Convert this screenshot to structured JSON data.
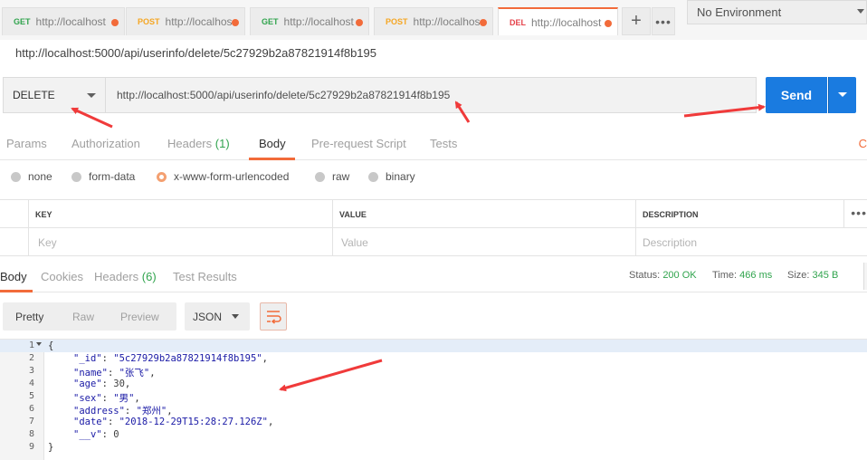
{
  "tabs": [
    {
      "method": "GET",
      "url": "http://localhost"
    },
    {
      "method": "POST",
      "url": "http://localhos"
    },
    {
      "method": "GET",
      "url": "http://localhost"
    },
    {
      "method": "POST",
      "url": "http://localhos"
    },
    {
      "method": "DEL",
      "url": "http://localhost"
    }
  ],
  "tab_controls": {
    "add": "+",
    "more": "•••"
  },
  "environment": {
    "selected": "No Environment"
  },
  "request": {
    "title": "http://localhost:5000/api/userinfo/delete/5c27929b2a87821914f8b195",
    "method": "DELETE",
    "url": "http://localhost:5000/api/userinfo/delete/5c27929b2a87821914f8b195",
    "send_label": "Send"
  },
  "request_tabs": {
    "params": "Params",
    "authorization": "Authorization",
    "headers": "Headers",
    "headers_count": "(1)",
    "body": "Body",
    "prerequest": "Pre-request Script",
    "tests": "Tests",
    "cookies_edge": "C"
  },
  "body_modes": {
    "none": "none",
    "form_data": "form-data",
    "urlencoded": "x-www-form-urlencoded",
    "raw": "raw",
    "binary": "binary"
  },
  "kv_table": {
    "headers": {
      "key": "KEY",
      "value": "VALUE",
      "description": "DESCRIPTION"
    },
    "placeholders": {
      "key": "Key",
      "value": "Value",
      "description": "Description"
    },
    "more": "•••"
  },
  "response_tabs": {
    "body": "Body",
    "cookies": "Cookies",
    "headers": "Headers",
    "headers_count": "(6)",
    "test_results": "Test Results"
  },
  "response_status": {
    "status_label": "Status:",
    "status_value": "200 OK",
    "time_label": "Time:",
    "time_value": "466 ms",
    "size_label": "Size:",
    "size_value": "345 B"
  },
  "view_modes": {
    "pretty": "Pretty",
    "raw": "Raw",
    "preview": "Preview",
    "format": "JSON"
  },
  "response_body": {
    "line_numbers": [
      "1",
      "2",
      "3",
      "4",
      "5",
      "6",
      "7",
      "8",
      "9"
    ],
    "open_brace": "{",
    "close_brace": "}",
    "fields": [
      {
        "key": "\"_id\"",
        "value": "\"5c27929b2a87821914f8b195\"",
        "suffix": ","
      },
      {
        "key": "\"name\"",
        "value": "\"张飞\"",
        "suffix": ","
      },
      {
        "key": "\"age\"",
        "value": "30",
        "suffix": ","
      },
      {
        "key": "\"sex\"",
        "value": "\"男\"",
        "suffix": ","
      },
      {
        "key": "\"address\"",
        "value": "\"郑州\"",
        "suffix": ","
      },
      {
        "key": "\"date\"",
        "value": "\"2018-12-29T15:28:27.126Z\"",
        "suffix": ","
      },
      {
        "key": "\"__v\"",
        "value": "0",
        "suffix": ""
      }
    ]
  },
  "colors": {
    "accent": "#f26b3a",
    "send": "#1a7be0",
    "ok": "#31a44e",
    "annotation_arrow": "#f03a3a"
  }
}
